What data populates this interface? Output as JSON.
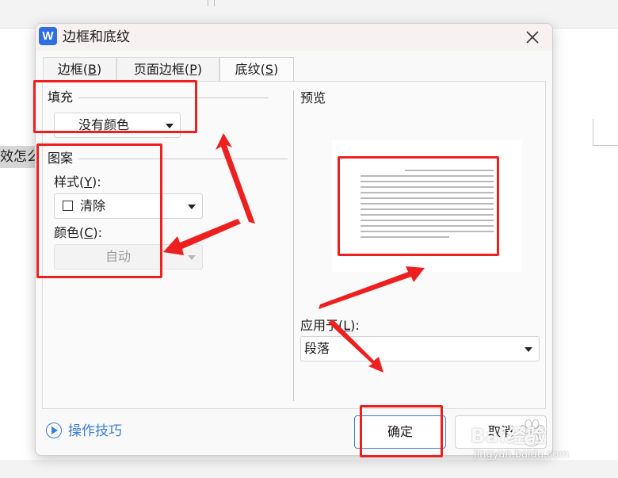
{
  "document": {
    "snippet": "效怎么"
  },
  "dialog": {
    "app_icon": "W",
    "title": "边框和底纹",
    "close_icon": "close-icon"
  },
  "tabs": [
    {
      "label": "边框(",
      "key": "B",
      "suffix": ")",
      "active": false
    },
    {
      "label": "页面边框(",
      "key": "P",
      "suffix": ")",
      "active": false
    },
    {
      "label": "底纹(",
      "key": "S",
      "suffix": ")",
      "active": true
    }
  ],
  "fill": {
    "label": "填充",
    "value": "没有颜色"
  },
  "pattern": {
    "label": "图案",
    "style_label": "样式(",
    "style_key": "Y",
    "style_suffix": "):",
    "style_value": "清除",
    "color_label": "颜色(",
    "color_key": "C",
    "color_suffix": "):",
    "color_value": "自动"
  },
  "preview": {
    "label": "预览"
  },
  "apply": {
    "label": "应用于(",
    "key": "L",
    "suffix": "):",
    "value": "段落"
  },
  "footer": {
    "help_label": "操作技巧",
    "ok_label": "确定",
    "cancel_label": "取消"
  },
  "watermark": {
    "text": "Bai经验",
    "url": "jingyan.baidu.com"
  },
  "colors": {
    "accent": "#3b7fd9",
    "annotation": "#ee1f1f",
    "app_icon_bg": "#2f6fe4"
  }
}
